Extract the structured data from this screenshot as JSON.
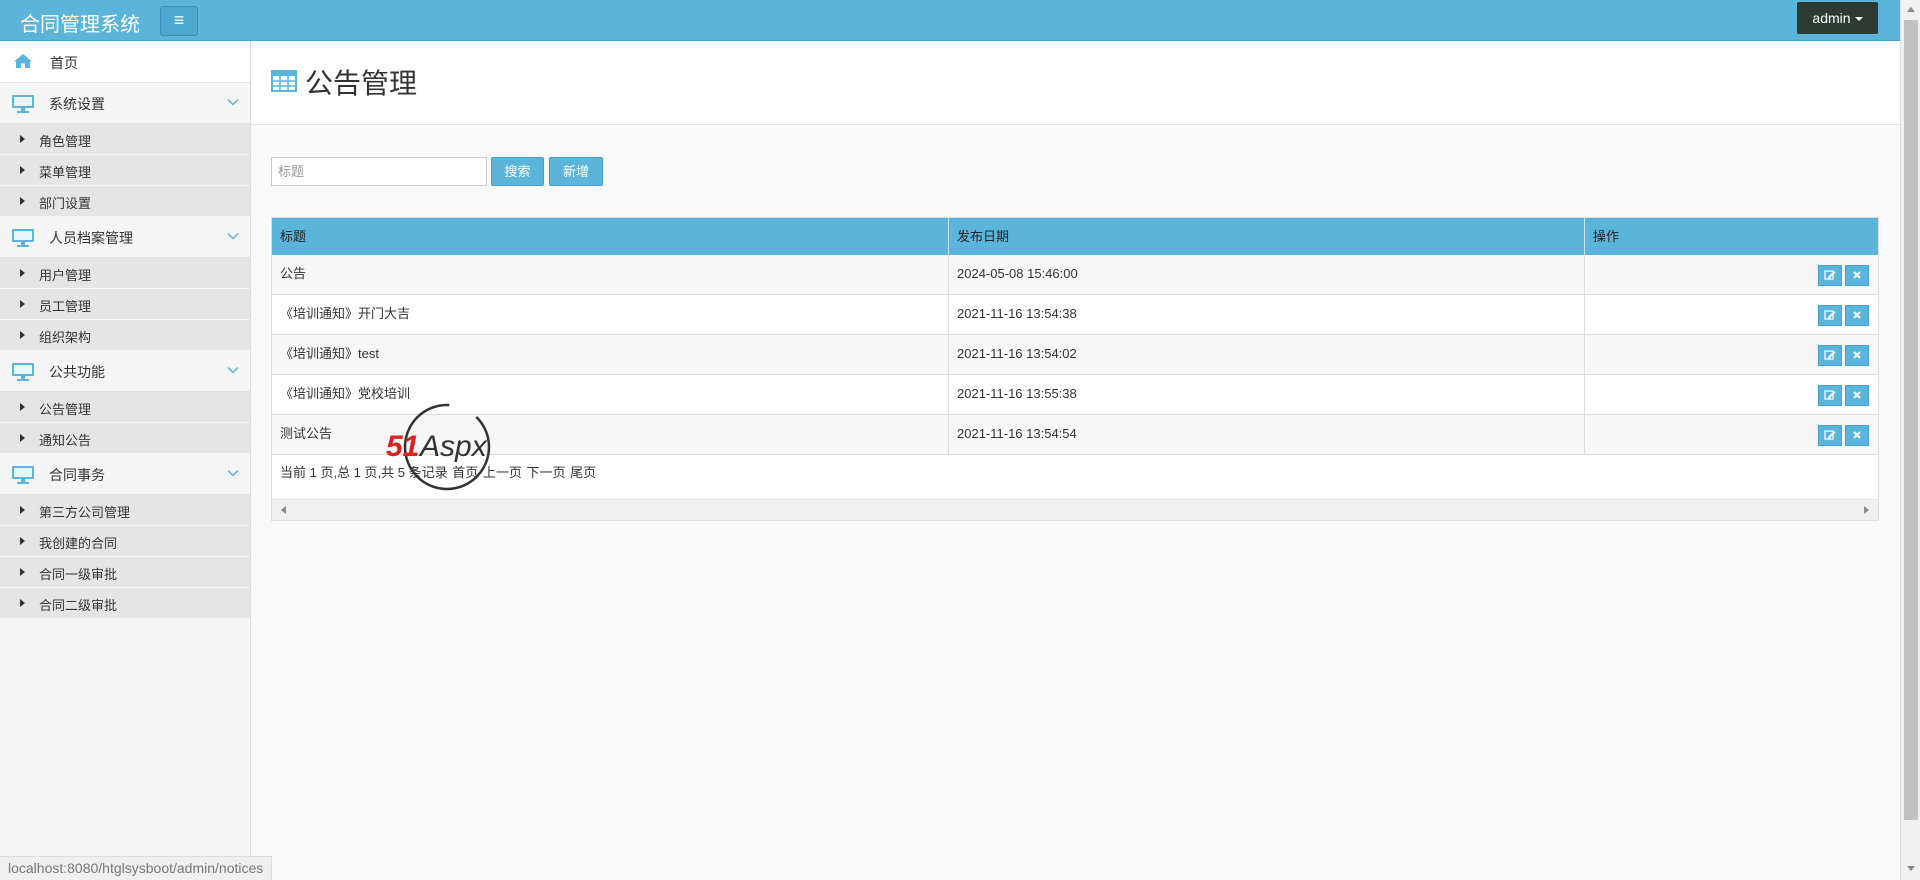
{
  "app": {
    "brand": "合同管理系统",
    "user": "admin"
  },
  "sidebar": {
    "home": "首页",
    "groups": [
      {
        "label": "系统设置",
        "items": [
          "角色管理",
          "菜单管理",
          "部门设置"
        ]
      },
      {
        "label": "人员档案管理",
        "items": [
          "用户管理",
          "员工管理",
          "组织架构"
        ]
      },
      {
        "label": "公共功能",
        "items": [
          "公告管理",
          "通知公告"
        ]
      },
      {
        "label": "合同事务",
        "items": [
          "第三方公司管理",
          "我创建的合同",
          "合同一级审批",
          "合同二级审批"
        ]
      }
    ]
  },
  "page": {
    "title": "公告管理"
  },
  "search": {
    "placeholder": "标题",
    "search_label": "搜索",
    "add_label": "新增"
  },
  "table": {
    "headers": [
      "标题",
      "发布日期",
      "操作"
    ],
    "rows": [
      [
        "公告",
        "2024-05-08 15:46:00"
      ],
      [
        "《培训通知》开门大吉",
        "2021-11-16 13:54:38"
      ],
      [
        "《培训通知》test",
        "2021-11-16 13:54:02"
      ],
      [
        "《培训通知》党校培训",
        "2021-11-16 13:55:38"
      ],
      [
        "测试公告",
        "2021-11-16 13:54:54"
      ]
    ]
  },
  "pager": {
    "summary": "当前 1 页,总 1 页,共 5 条记录",
    "first": "首页",
    "prev": "上一页",
    "next": "下一页",
    "last": "尾页"
  },
  "status_url": "localhost:8080/htglsysboot/admin/notices",
  "watermark": {
    "text_red": "51",
    "text_dark": "Aspx"
  },
  "colors": {
    "primary": "#5bb5db",
    "user_button": "#2f3a32",
    "watermark_red": "#e02020",
    "watermark_green": "#3aa33a"
  }
}
